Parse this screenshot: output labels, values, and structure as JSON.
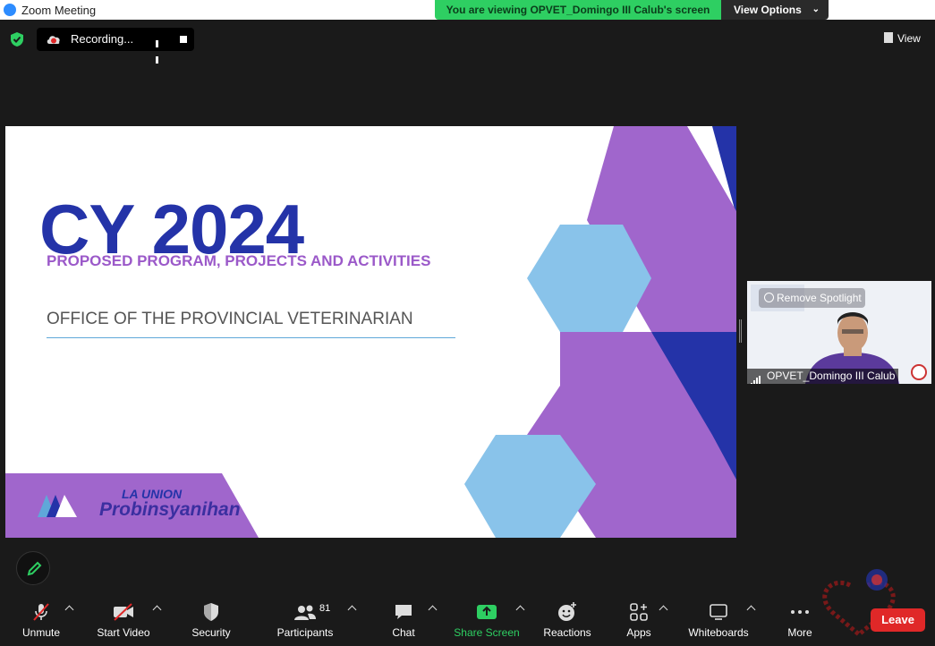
{
  "window": {
    "title": "Zoom Meeting"
  },
  "banner": {
    "text": "You are viewing OPVET_Domingo III Calub's screen",
    "view_options": "View Options"
  },
  "recording": {
    "label": "Recording..."
  },
  "top_right": {
    "view_label": "View"
  },
  "slide": {
    "headline": "CY 2024",
    "subtitle": "PROPOSED PROGRAM, PROJECTS AND ACTIVITIES",
    "office": "OFFICE OF THE PROVINCIAL VETERINARIAN",
    "brand_top": "LA UNION",
    "brand_bottom": "Probinsyanihan"
  },
  "thumbnail": {
    "spotlight_label": "Remove Spotlight",
    "participant_name": "OPVET_Domingo III Calub"
  },
  "toolbar": {
    "unmute": "Unmute",
    "start_video": "Start Video",
    "security": "Security",
    "participants": "Participants",
    "participants_count": "81",
    "chat": "Chat",
    "share_screen": "Share Screen",
    "reactions": "Reactions",
    "apps": "Apps",
    "whiteboards": "Whiteboards",
    "more": "More",
    "leave": "Leave"
  },
  "colors": {
    "share_green": "#2ecf62",
    "leave_red": "#e02828",
    "slide_purple": "#a066cc",
    "slide_navy": "#2433a8",
    "slide_lightblue": "#89c3ea"
  }
}
